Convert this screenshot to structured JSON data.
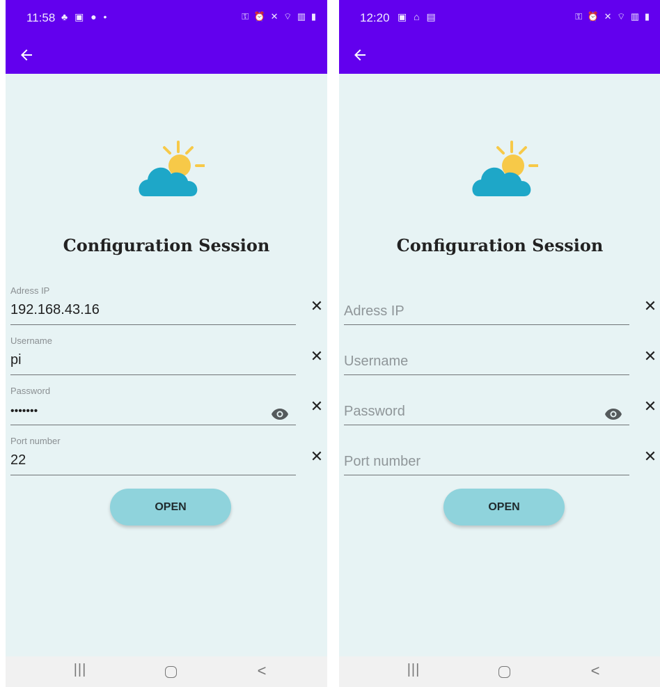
{
  "screens": [
    {
      "status_bar": {
        "time": "11:58",
        "left_icons": "♣ ▣ ● •",
        "right_icons": "⚿ ⏰ ✕ ⌔ ▥ ▮"
      },
      "title": "Configuration Session",
      "fields": {
        "adress_ip": {
          "label": "Adress IP",
          "value": "192.168.43.16"
        },
        "username": {
          "label": "Username",
          "value": "pi"
        },
        "password": {
          "label": "Password",
          "value": "•••••••"
        },
        "port": {
          "label": "Port number",
          "value": "22"
        }
      },
      "open_button": "OPEN"
    },
    {
      "status_bar": {
        "time": "12:20",
        "left_icons": "▣ ⌂ ▤",
        "right_icons": "⚿ ⏰ ✕ ⌔ ▥ ▮"
      },
      "title": "Configuration Session",
      "fields": {
        "adress_ip": {
          "placeholder": "Adress IP"
        },
        "username": {
          "placeholder": "Username"
        },
        "password": {
          "placeholder": "Password"
        },
        "port": {
          "placeholder": "Port number"
        }
      },
      "open_button": "OPEN"
    }
  ],
  "icons": {
    "back": "arrow-left-icon",
    "clear": "close-icon",
    "visibility": "eye-icon",
    "logo": "cloud-sun-icon",
    "nav_recents": "recents-icon",
    "nav_home": "home-icon",
    "nav_back": "chevron-left-icon"
  },
  "nav": {
    "recents": "|||",
    "back": "<"
  },
  "colors": {
    "app_bar": "#6200ee",
    "background": "#e7f3f4",
    "button": "#8fd3dc",
    "cloud": "#1ea7c8",
    "sun": "#f7c948"
  }
}
